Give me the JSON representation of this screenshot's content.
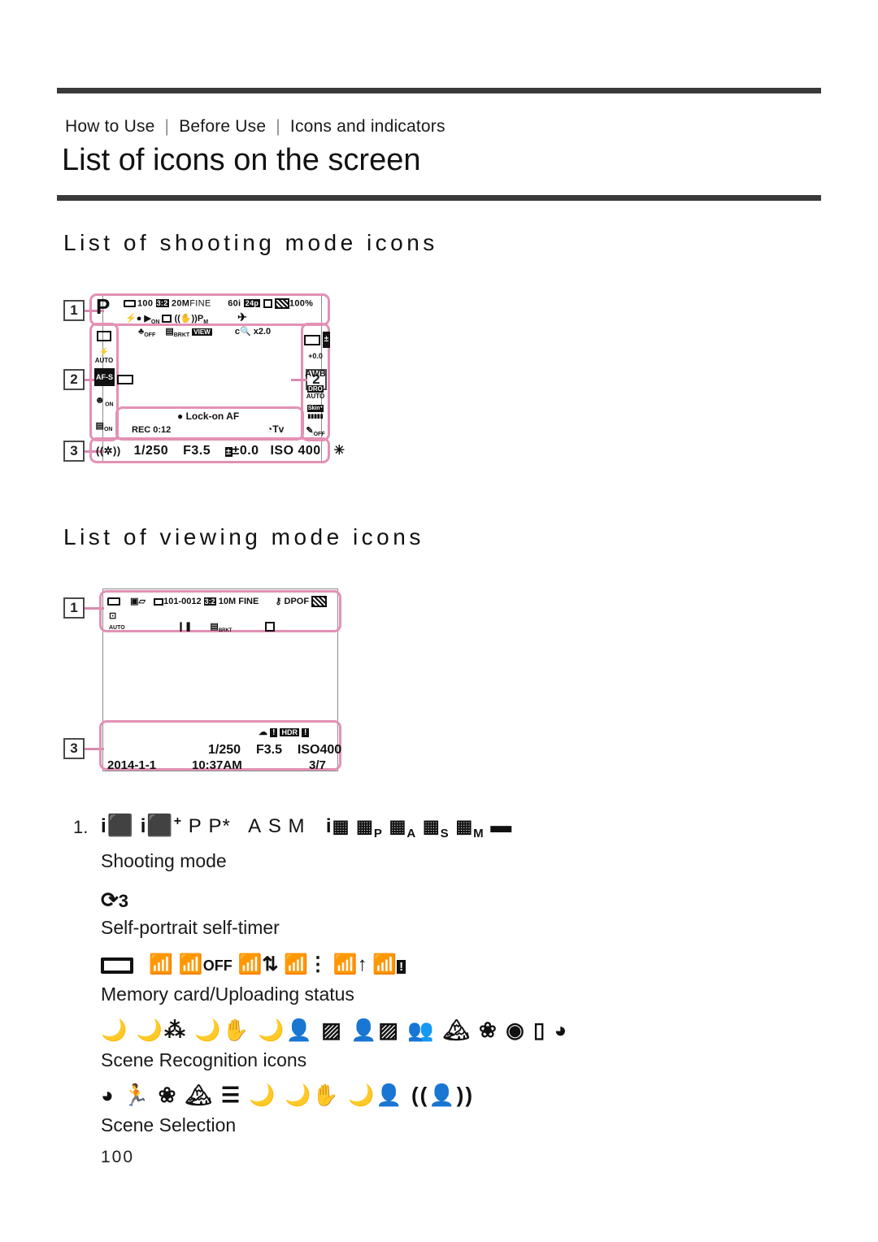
{
  "header": {
    "breadcrumb": [
      "How to Use",
      "Before Use",
      "Icons and indicators"
    ],
    "title": "List of icons on the screen"
  },
  "sections": [
    {
      "id": "shooting",
      "title": "List of shooting mode icons"
    },
    {
      "id": "viewing",
      "title": "List of viewing mode icons"
    }
  ],
  "colors": {
    "pink_outline": "#e391b5",
    "rule": "#3a3a3a",
    "callout_border": "#4a4a4a",
    "lcd_border": "#8d8d8d",
    "text": "#1a1a1a"
  },
  "shooting_screen": {
    "callouts": [
      "1",
      "2",
      "3"
    ],
    "area1": {
      "row1": [
        "P",
        "100",
        "3:2",
        "20M",
        "FINE",
        "60i",
        "24p",
        "N",
        "100%"
      ],
      "row2": [
        "flash-charge",
        "audio-rec-on",
        "aspect-marker",
        "steadyshot",
        "P",
        "airplane-mode"
      ],
      "row3": [
        "mic-off",
        "drive-bracket-dro",
        "VIEW",
        "c-zoom",
        "x2.0"
      ]
    },
    "area2_left": [
      "drive-mode-single",
      "flash-auto",
      "AF-S",
      "af-area-wide",
      "smile-detect-on",
      "face-reg-on"
    ],
    "area2_right": [
      "focus-area",
      "exposure-comp",
      "+0.0",
      "AWB",
      "DRO-AUTO",
      "soft-skin",
      "pict-effect-off"
    ],
    "center": {
      "lock_on_af": "Lock-on AF",
      "rec_time": "REC 0:12",
      "tv_mark": "Tv"
    },
    "area3": {
      "items": [
        "steadyshot",
        "1/250",
        "F3.5",
        "±0.0",
        "ISO 400",
        "AE-lock"
      ],
      "shutter": "1/250",
      "aperture": "F3.5",
      "ev": "±0.0",
      "iso": "ISO 400"
    }
  },
  "viewing_screen": {
    "callouts": [
      "1",
      "3"
    ],
    "area1": {
      "row1": [
        "memory-card",
        "view-mode",
        "folder-file",
        "101-0012",
        "3:2",
        "10M",
        "FINE",
        "protect-key",
        "DPOF",
        "battery"
      ],
      "row2": [
        "auto-object-framing",
        "master-slave",
        "bracket-dro",
        "nfc"
      ]
    },
    "area3": {
      "icons": [
        "protect-mic",
        "warn-1",
        "HDR",
        "warn-2"
      ],
      "shutter": "1/250",
      "aperture": "F3.5",
      "iso": "ISO400",
      "date": "2014-1-1",
      "time": "10:37AM",
      "counter": "3/7"
    }
  },
  "icon_list": [
    {
      "num": "1.",
      "icons": [
        "iAuto",
        "iAuto+",
        "P",
        "P*",
        "A",
        "S",
        "M",
        "iMovie",
        "MovieP",
        "MovieA",
        "MovieS",
        "MovieM",
        "Panorama"
      ],
      "icons_text": "i◼ i◼+ P P*  A  S  M  i▥ ▥P ▥A ▥S ▥M ▭",
      "label": "Shooting mode"
    },
    {
      "num": "",
      "icons": [
        "self-portrait-self-timer-3"
      ],
      "icons_text": "⟳3",
      "label": "Self-portrait self-timer"
    },
    {
      "num": "",
      "icons": [
        "memory-card",
        "wifi-card",
        "wifi-card-off",
        "wifi-card-transfer",
        "wifi-card-waiting",
        "wifi-card-upload",
        "wifi-card-error"
      ],
      "icons_text": "▭ ⌸ ⌸OFF ⌸⇅ ⌸⋮ ⌸↑ ⌸!",
      "label": "Memory card/Uploading status"
    },
    {
      "num": "",
      "icons": [
        "night-scene",
        "night-scene-tripod",
        "hand-held-twilight",
        "night-portrait",
        "backlight",
        "backlight-portrait",
        "portrait",
        "landscape",
        "macro",
        "spotlight",
        "low-light",
        "baby"
      ],
      "icons_text": "☽ ☽⁂ ☽✋ ☽👤 ▨ ▨👤 👤 ▲▲ ❀ ◉ ▯ ◕",
      "label": "Scene Recognition icons"
    },
    {
      "num": "",
      "icons": [
        "portrait",
        "sports-action",
        "macro",
        "landscape",
        "sunset",
        "night-scene",
        "hand-held-twilight",
        "night-portrait",
        "anti-motion-blur"
      ],
      "icons_text": "◕ ⛷ ❀ ▲▲ ☰ ☽ ☽✋ ☽👤 ((👤))",
      "label": "Scene Selection"
    }
  ],
  "page_number": "100"
}
